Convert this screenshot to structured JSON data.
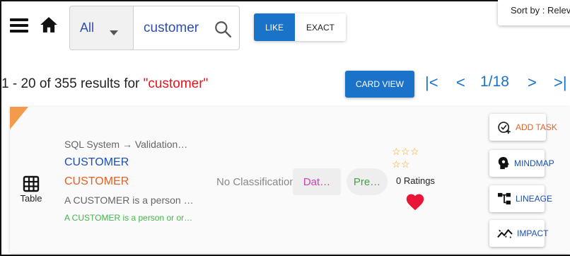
{
  "header": {
    "scope_value": "All",
    "search_value": "customer",
    "match_like": "LIKE",
    "match_exact": "EXACT",
    "sort_label": "Sort by : Relevance"
  },
  "results": {
    "summary_prefix": "1 - 20 of 355 results for ",
    "query_quoted": "\"customer\"",
    "card_view_label": "CARD VIEW",
    "pager_first": "|<",
    "pager_prev": "<",
    "page_indicator": "1/18",
    "pager_next": ">",
    "pager_last": ">|"
  },
  "card": {
    "type_label": "Table",
    "breadcrumb": "SQL System → Validation…",
    "name": "CUSTOMER",
    "business_name": "CUSTOMER",
    "description": "A CUSTOMER is a person …",
    "business_description": "A CUSTOMER is a person or or…",
    "classification": "No Classification",
    "chip_data": "Dat…",
    "chip_pre": "Pre…",
    "ratings_text": "0 Ratings",
    "rating_value": 0,
    "favorite": true,
    "actions": {
      "add_task": "ADD TASK",
      "mindmap": "MINDMAP",
      "lineage": "LINEAGE",
      "impact": "IMPACT"
    }
  },
  "colors": {
    "primary_blue": "#1a73c9",
    "query_red": "#e3141b",
    "name_blue": "#1b4fb0",
    "orange": "#e0622a",
    "green": "#43b54a",
    "star": "#f0a81c",
    "heart": "#e8173a"
  },
  "icons": [
    "menu-icon",
    "home-icon",
    "chevron-down-icon",
    "search-icon",
    "table-icon",
    "star-icon",
    "heart-icon",
    "add-task-icon",
    "mindmap-icon",
    "lineage-icon",
    "impact-icon"
  ]
}
